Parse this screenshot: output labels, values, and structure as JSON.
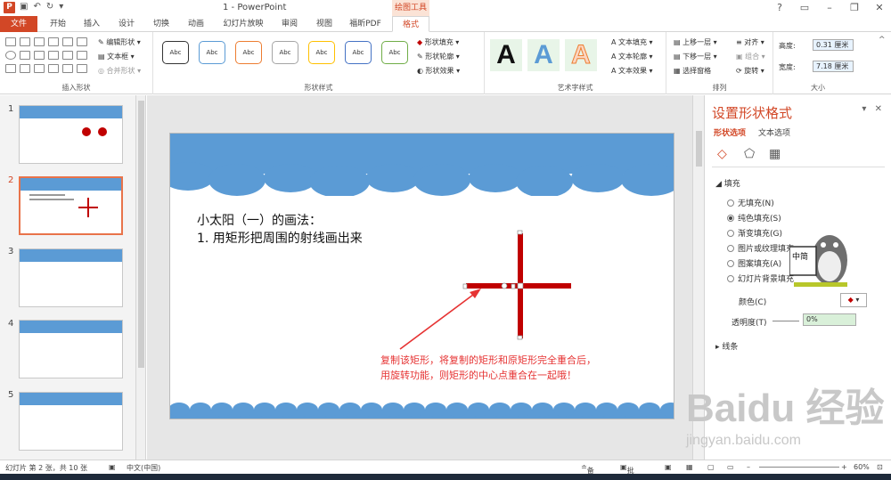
{
  "window": {
    "title": "1 - PowerPoint",
    "context_header": "绘图工具",
    "app_icon": "P"
  },
  "tabs": [
    {
      "label": "文件"
    },
    {
      "label": "开始"
    },
    {
      "label": "插入"
    },
    {
      "label": "设计"
    },
    {
      "label": "切换"
    },
    {
      "label": "动画"
    },
    {
      "label": "幻灯片放映"
    },
    {
      "label": "审阅"
    },
    {
      "label": "视图"
    },
    {
      "label": "福昕PDF"
    },
    {
      "label": "格式"
    }
  ],
  "ribbon": {
    "insert_shapes": {
      "label": "插入形状",
      "edit_shape": "编辑形状",
      "text_box": "文本框",
      "merge_shapes": "合并形状"
    },
    "shape_styles": {
      "label": "形状样式",
      "swatch_text": "Abc",
      "fill": "形状填充",
      "outline": "形状轮廓",
      "effects": "形状效果",
      "swatch_colors": [
        "#333333",
        "#5b9bd5",
        "#ed7d31",
        "#a5a5a5",
        "#ffc000",
        "#4472c4",
        "#70ad47"
      ]
    },
    "wordart": {
      "label": "艺术字样式",
      "sample": "A",
      "text_fill": "文本填充",
      "text_outline": "文本轮廓",
      "text_effects": "文本效果"
    },
    "arrange": {
      "label": "排列",
      "bring_forward": "上移一层",
      "send_backward": "下移一层",
      "selection_pane": "选择窗格",
      "align": "对齐",
      "group": "组合",
      "rotate": "旋转"
    },
    "size": {
      "label": "大小",
      "height_label": "高度:",
      "height_value": "0.31 厘米",
      "width_label": "宽度:",
      "width_value": "7.18 厘米"
    }
  },
  "thumbnails": [
    {
      "number": "1",
      "selected": false
    },
    {
      "number": "2",
      "selected": true
    },
    {
      "number": "3",
      "selected": false
    },
    {
      "number": "4",
      "selected": false
    },
    {
      "number": "5",
      "selected": false
    }
  ],
  "slide": {
    "title_line1": "小太阳（一）的画法：",
    "title_line2": "1. 用矩形把周围的射线画出来",
    "annotation_line1": "复制该矩形，将复制的矩形和原矩形完全重合后，",
    "annotation_line2": "用旋转功能，则矩形的中心点重合在一起哦！",
    "cross_color": "#c00000",
    "cloud_color": "#5b9bd5",
    "arrow_color": "#e63333"
  },
  "format_pane": {
    "title": "设置形状格式",
    "tab_shape": "形状选项",
    "tab_text": "文本选项",
    "fill_section": "填充",
    "options": [
      {
        "label": "无填充(N)",
        "selected": false
      },
      {
        "label": "纯色填充(S)",
        "selected": true
      },
      {
        "label": "渐变填充(G)",
        "selected": false
      },
      {
        "label": "图片或纹理填充",
        "selected": false
      },
      {
        "label": "图案填充(A)",
        "selected": false
      },
      {
        "label": "幻灯片背景填充",
        "selected": false
      }
    ],
    "color_label": "颜色(C)",
    "transparency_label": "透明度(T)",
    "transparency_value": "0%",
    "line_section": "线条",
    "sticker_text": "中简"
  },
  "status": {
    "slide_info": "幻灯片 第 2 张，共 10 张",
    "language": "中文(中国)",
    "notes": "备注",
    "comments": "批注",
    "zoom": "60%"
  },
  "watermark": {
    "logo": "Baidu 经验",
    "url": "jingyan.baidu.com"
  }
}
